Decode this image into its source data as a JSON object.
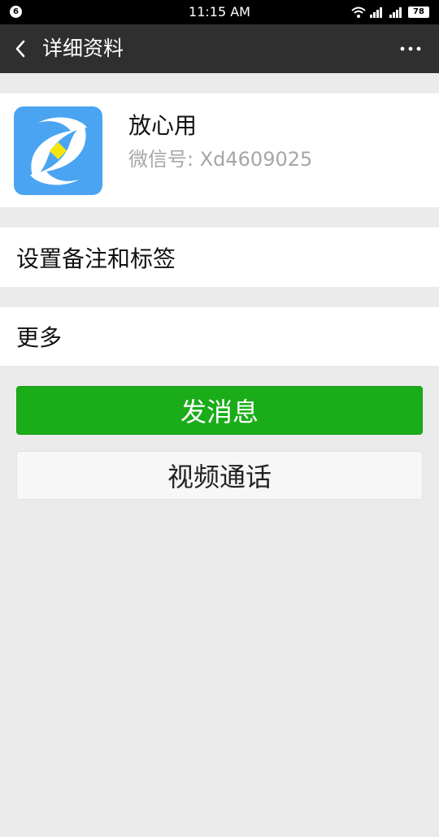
{
  "status_bar": {
    "notification_badge": "6",
    "time": "11:15 AM",
    "battery": "78",
    "icons": [
      "wifi-icon",
      "signal-icon",
      "signal-icon"
    ]
  },
  "titlebar": {
    "title": "详细资料",
    "back_icon": "chevron-left-icon",
    "more_icon": "more-dots-icon"
  },
  "profile": {
    "name": "放心用",
    "wechat_id": "微信号: Xd4609025",
    "avatar_colors": {
      "background": "#4aa4f2",
      "shape": "#ffffff",
      "diamond": "#f5e60f"
    }
  },
  "rows": {
    "remark_label": "设置备注和标签",
    "more_label": "更多"
  },
  "buttons": {
    "send_message": "发消息",
    "video_call": "视频通话"
  },
  "colors": {
    "primary_green": "#1aad19",
    "titlebar_bg": "#2f2f2f",
    "page_bg": "#ebebeb"
  }
}
